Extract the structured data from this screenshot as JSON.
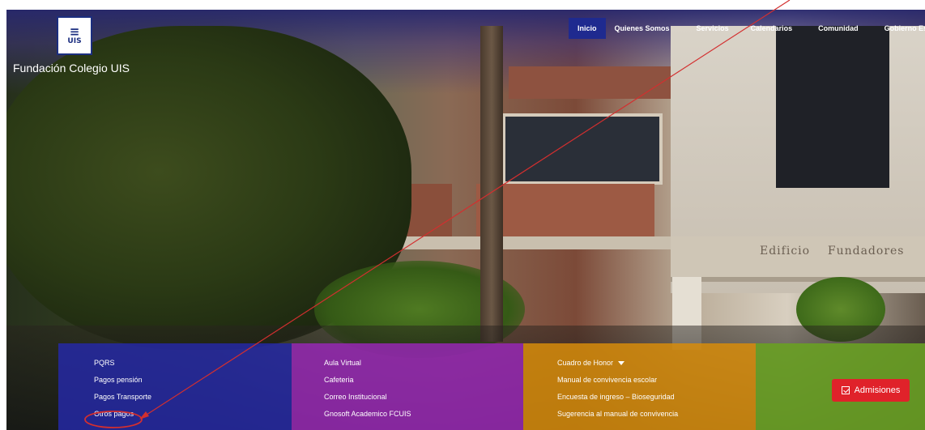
{
  "brand": {
    "name": "Fundación Colegio UIS",
    "logo_text": "UIS"
  },
  "nav": [
    {
      "label": "Inicio",
      "active": true
    },
    {
      "label": "Quienes Somos"
    },
    {
      "label": "Servicios"
    },
    {
      "label": "Calendarios"
    },
    {
      "label": "Comunidad"
    },
    {
      "label": "Gobierno Es"
    }
  ],
  "hero": {
    "building_sign": "Edificio    Fundadores"
  },
  "panels": {
    "col1": [
      "PQRS",
      "Pagos pensión",
      "Pagos Transporte",
      "Otros pagos"
    ],
    "col2": [
      "Aula Virtual",
      "Cafeteria",
      "Correo Institucional",
      "Gnosoft Academico FCUIS"
    ],
    "col3": [
      "Cuadro de Honor",
      "Manual de convivencia escolar",
      "Encuesta de ingreso – Bioseguridad",
      "Sugerencia al manual de convivencia"
    ]
  },
  "cta": {
    "label": "Admisiones",
    "icon": "calendar-check-icon",
    "color": "#e0222a"
  },
  "colors": {
    "panel1": "#2428aa",
    "panel2": "#9628b4",
    "panel3": "#d78c0a",
    "panel4": "#69a023",
    "annotation": "#d32f2f"
  }
}
